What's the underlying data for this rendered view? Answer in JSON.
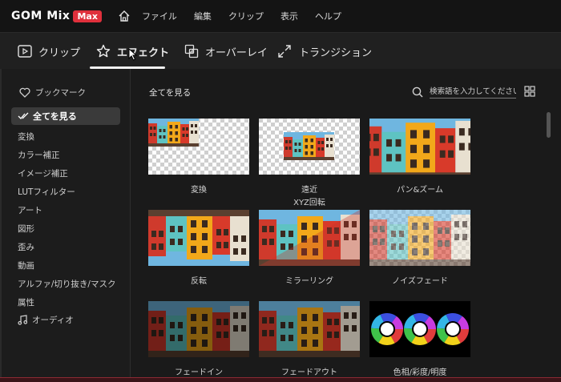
{
  "app": {
    "logo_text": "GOM Mix",
    "logo_badge": "Max",
    "menu": [
      "ファイル",
      "編集",
      "クリップ",
      "表示",
      "ヘルプ"
    ]
  },
  "tabs": [
    {
      "label": "クリップ",
      "icon": "play-square-icon"
    },
    {
      "label": "エフェクト",
      "icon": "star-icon",
      "active": true
    },
    {
      "label": "オーバーレイ",
      "icon": "overlay-icon"
    },
    {
      "label": "トランジション",
      "icon": "transition-icon"
    }
  ],
  "sidebar": {
    "bookmark": "ブックマーク",
    "all": "全てを見る",
    "items": [
      "変換",
      "カラー補正",
      "イメージ補正",
      "LUTフィルター",
      "アート",
      "図形",
      "歪み",
      "動画",
      "アルファ/切り抜き/マスク",
      "属性"
    ],
    "audio": "オーディオ"
  },
  "main": {
    "header": "全てを見る",
    "search_placeholder": "検索語を入力してください。"
  },
  "effects": [
    {
      "label": "変換"
    },
    {
      "label": "遠近",
      "label2": "XYZ回転"
    },
    {
      "label": "パン&ズーム"
    },
    {
      "label": "反転"
    },
    {
      "label": "ミラーリング"
    },
    {
      "label": "ノイズフェード"
    },
    {
      "label": "フェードイン"
    },
    {
      "label": "フェードアウト"
    },
    {
      "label": "色相/彩度/明度"
    }
  ],
  "colors": {
    "accent": "#e0303c",
    "active_item_bg": "#3a3a3a"
  }
}
